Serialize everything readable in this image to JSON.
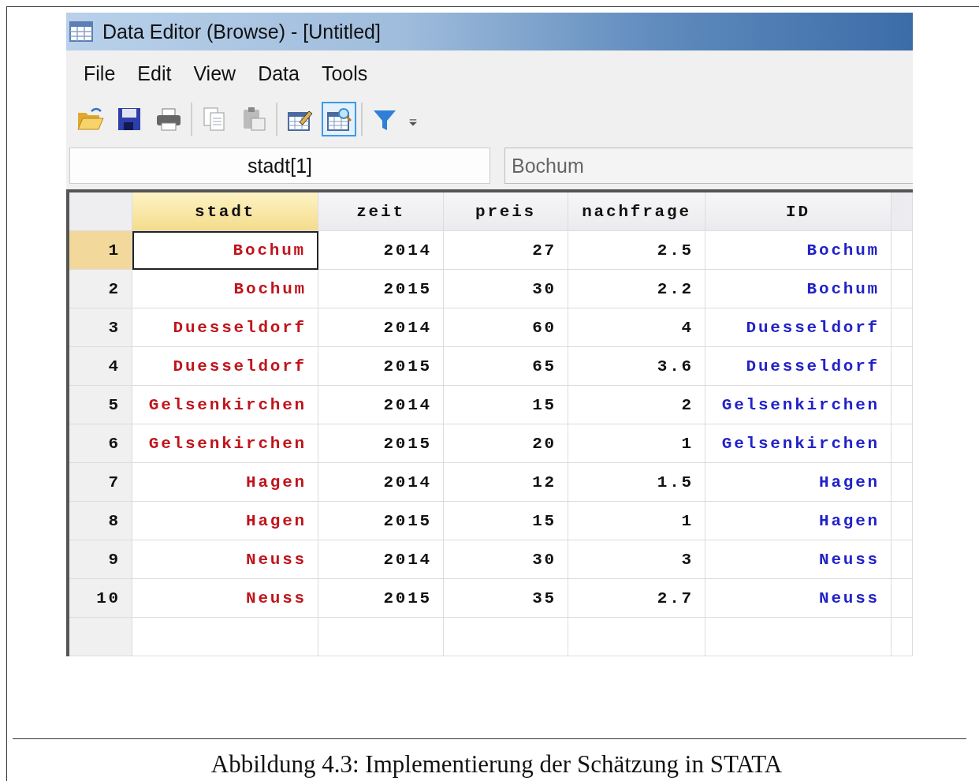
{
  "window": {
    "title": "Data Editor (Browse) - [Untitled]"
  },
  "menu": [
    "File",
    "Edit",
    "View",
    "Data",
    "Tools"
  ],
  "toolbar": [
    {
      "kind": "open",
      "selected": false
    },
    {
      "kind": "save",
      "selected": false
    },
    {
      "kind": "print",
      "selected": false
    },
    {
      "kind": "separator"
    },
    {
      "kind": "copy",
      "selected": false
    },
    {
      "kind": "paste",
      "selected": false
    },
    {
      "kind": "separator"
    },
    {
      "kind": "edit",
      "selected": false
    },
    {
      "kind": "browse",
      "selected": true
    },
    {
      "kind": "separator"
    },
    {
      "kind": "filter",
      "selected": false
    },
    {
      "kind": "dropdown",
      "selected": false
    }
  ],
  "cell_name": "stadt[1]",
  "cell_value": "Bochum",
  "table": {
    "columns": [
      {
        "name": "stadt",
        "kind": "string",
        "selected": true
      },
      {
        "name": "zeit",
        "kind": "numeric",
        "selected": false
      },
      {
        "name": "preis",
        "kind": "numeric",
        "selected": false
      },
      {
        "name": "nachfrage",
        "kind": "numeric",
        "selected": false
      },
      {
        "name": "ID",
        "kind": "labeled",
        "selected": false
      }
    ],
    "rows": [
      {
        "number": "1",
        "selected": true,
        "cells": [
          "Bochum",
          "2014",
          "27",
          "2.5",
          "Bochum"
        ]
      },
      {
        "number": "2",
        "selected": false,
        "cells": [
          "Bochum",
          "2015",
          "30",
          "2.2",
          "Bochum"
        ]
      },
      {
        "number": "3",
        "selected": false,
        "cells": [
          "Duesseldorf",
          "2014",
          "60",
          "4",
          "Duesseldorf"
        ]
      },
      {
        "number": "4",
        "selected": false,
        "cells": [
          "Duesseldorf",
          "2015",
          "65",
          "3.6",
          "Duesseldorf"
        ]
      },
      {
        "number": "5",
        "selected": false,
        "cells": [
          "Gelsenkirchen",
          "2014",
          "15",
          "2",
          "Gelsenkirchen"
        ]
      },
      {
        "number": "6",
        "selected": false,
        "cells": [
          "Gelsenkirchen",
          "2015",
          "20",
          "1",
          "Gelsenkirchen"
        ]
      },
      {
        "number": "7",
        "selected": false,
        "cells": [
          "Hagen",
          "2014",
          "12",
          "1.5",
          "Hagen"
        ]
      },
      {
        "number": "8",
        "selected": false,
        "cells": [
          "Hagen",
          "2015",
          "15",
          "1",
          "Hagen"
        ]
      },
      {
        "number": "9",
        "selected": false,
        "cells": [
          "Neuss",
          "2014",
          "30",
          "3",
          "Neuss"
        ]
      },
      {
        "number": "10",
        "selected": false,
        "cells": [
          "Neuss",
          "2015",
          "35",
          "2.7",
          "Neuss"
        ]
      }
    ]
  },
  "caption": "Abbildung 4.3: Implementierung der Schätzung in STATA"
}
